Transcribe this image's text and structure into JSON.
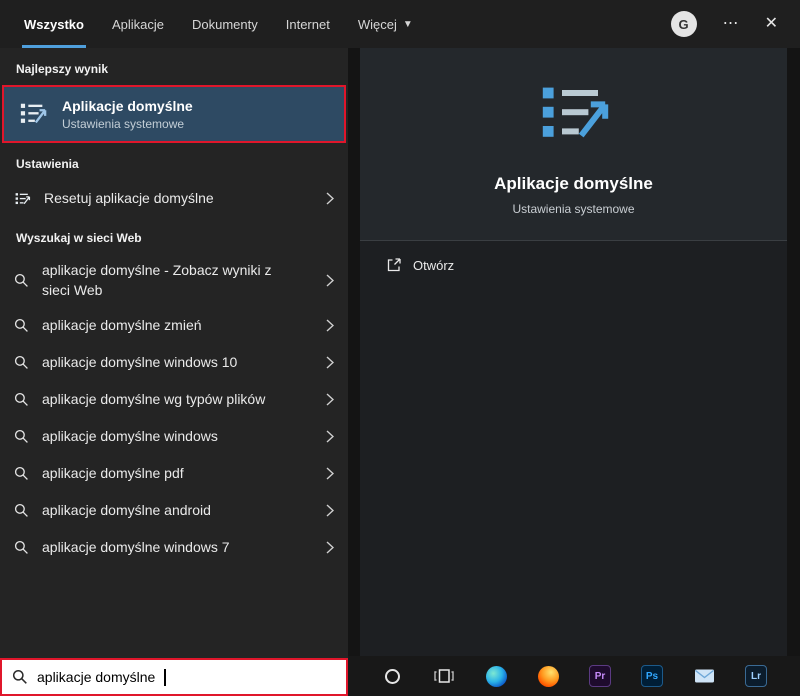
{
  "colors": {
    "accent": "#4f9fdc",
    "annotation_red": "#e0162b",
    "highlight": "#2e4a63"
  },
  "tabbar": {
    "tabs": [
      {
        "label": "Wszystko"
      },
      {
        "label": "Aplikacje"
      },
      {
        "label": "Dokumenty"
      },
      {
        "label": "Internet"
      },
      {
        "label": "Więcej"
      }
    ],
    "avatar": "G",
    "more_glyph": "⋯",
    "close_glyph": "✕"
  },
  "left": {
    "best_header": "Najlepszy wynik",
    "best": {
      "title": "Aplikacje domyślne",
      "subtitle": "Ustawienia systemowe"
    },
    "settings_header": "Ustawienia",
    "settings_item": "Resetuj aplikacje domyślne",
    "web_header": "Wyszukaj w sieci Web",
    "web_items": [
      {
        "label": "aplikacje domyślne - Zobacz wyniki z sieci Web"
      },
      {
        "label": "aplikacje domyślne zmień"
      },
      {
        "label": "aplikacje domyślne windows 10"
      },
      {
        "label": "aplikacje domyślne wg typów plików"
      },
      {
        "label": "aplikacje domyślne windows"
      },
      {
        "label": "aplikacje domyślne pdf"
      },
      {
        "label": "aplikacje domyślne android"
      },
      {
        "label": "aplikacje domyślne windows 7"
      }
    ]
  },
  "search": {
    "value": "aplikacje domyślne"
  },
  "preview": {
    "title": "Aplikacje domyślne",
    "subtitle": "Ustawienia systemowe",
    "open_label": "Otwórz"
  },
  "taskbar": {
    "premiere": "Pr",
    "photoshop": "Ps",
    "lightroom": "Lr"
  }
}
